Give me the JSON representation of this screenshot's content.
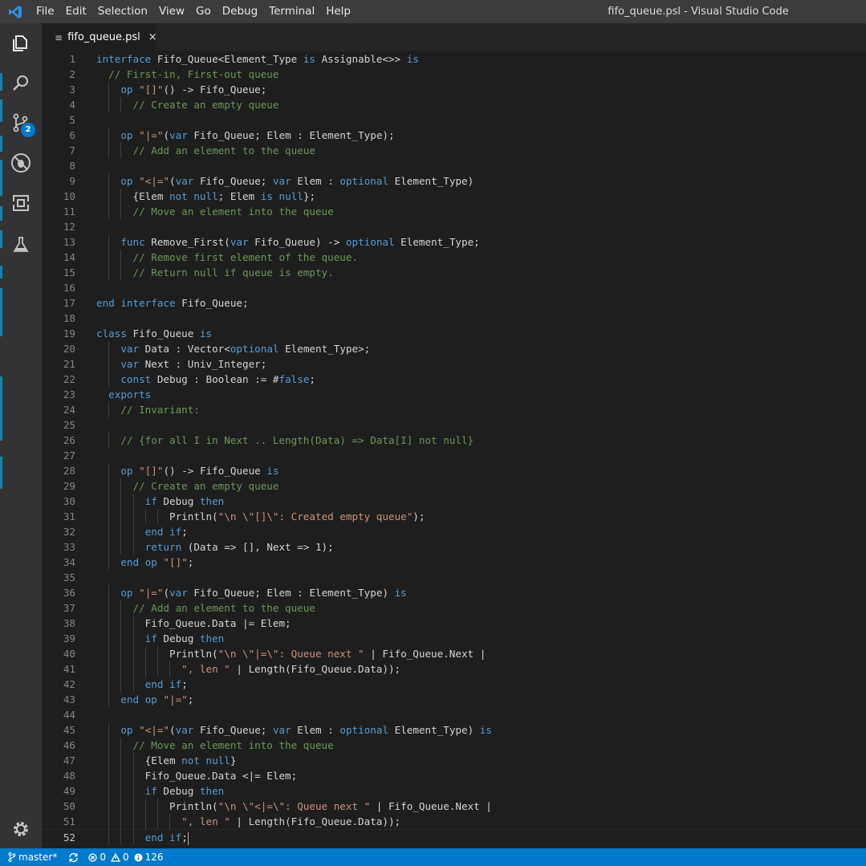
{
  "window": {
    "title": "fifo_queue.psl - Visual Studio Code"
  },
  "menu": [
    "File",
    "Edit",
    "Selection",
    "View",
    "Go",
    "Debug",
    "Terminal",
    "Help"
  ],
  "activity": {
    "items": [
      "explorer-icon",
      "search-icon",
      "source-control-icon",
      "debug-icon",
      "extensions-icon",
      "test-icon"
    ],
    "scm_badge": "2",
    "settings": "gear-icon"
  },
  "tab": {
    "label": "fifo_queue.psl",
    "close": "×"
  },
  "colors": {
    "keyword": "#569cd6",
    "comment": "#6a9955",
    "string": "#ce9178",
    "status": "#007acc"
  },
  "code": [
    {
      "n": "1",
      "t": "interface Fifo_Queue<Element_Type is Assignable<>> is"
    },
    {
      "n": "2",
      "t": "  // First-in, First-out queue"
    },
    {
      "n": "3",
      "t": "    op \"[]\"() -> Fifo_Queue;"
    },
    {
      "n": "4",
      "t": "      // Create an empty queue"
    },
    {
      "n": "5",
      "t": ""
    },
    {
      "n": "6",
      "t": "    op \"|=\"(var Fifo_Queue; Elem : Element_Type);"
    },
    {
      "n": "7",
      "t": "      // Add an element to the queue"
    },
    {
      "n": "8",
      "t": ""
    },
    {
      "n": "9",
      "t": "    op \"<|=\"(var Fifo_Queue; var Elem : optional Element_Type)"
    },
    {
      "n": "10",
      "t": "      {Elem not null; Elem is null};"
    },
    {
      "n": "11",
      "t": "      // Move an element into the queue"
    },
    {
      "n": "12",
      "t": ""
    },
    {
      "n": "13",
      "t": "    func Remove_First(var Fifo_Queue) -> optional Element_Type;"
    },
    {
      "n": "14",
      "t": "      // Remove first element of the queue."
    },
    {
      "n": "15",
      "t": "      // Return null if queue is empty."
    },
    {
      "n": "16",
      "t": ""
    },
    {
      "n": "17",
      "t": "end interface Fifo_Queue;"
    },
    {
      "n": "18",
      "t": ""
    },
    {
      "n": "19",
      "t": "class Fifo_Queue is"
    },
    {
      "n": "20",
      "t": "    var Data : Vector<optional Element_Type>;"
    },
    {
      "n": "21",
      "t": "    var Next : Univ_Integer;"
    },
    {
      "n": "22",
      "t": "    const Debug : Boolean := #false;"
    },
    {
      "n": "23",
      "t": "  exports"
    },
    {
      "n": "24",
      "t": "    // Invariant:"
    },
    {
      "n": "25",
      "t": ""
    },
    {
      "n": "26",
      "t": "    // {for all I in Next .. Length(Data) => Data[I] not null}"
    },
    {
      "n": "27",
      "t": ""
    },
    {
      "n": "28",
      "t": "    op \"[]\"() -> Fifo_Queue is"
    },
    {
      "n": "29",
      "t": "      // Create an empty queue"
    },
    {
      "n": "30",
      "t": "        if Debug then"
    },
    {
      "n": "31",
      "t": "            Println(\"\\n \\\"[]\\\": Created empty queue\");"
    },
    {
      "n": "32",
      "t": "        end if;"
    },
    {
      "n": "33",
      "t": "        return (Data => [], Next => 1);"
    },
    {
      "n": "34",
      "t": "    end op \"[]\";"
    },
    {
      "n": "35",
      "t": ""
    },
    {
      "n": "36",
      "t": "    op \"|=\"(var Fifo_Queue; Elem : Element_Type) is"
    },
    {
      "n": "37",
      "t": "      // Add an element to the queue"
    },
    {
      "n": "38",
      "t": "        Fifo_Queue.Data |= Elem;"
    },
    {
      "n": "39",
      "t": "        if Debug then"
    },
    {
      "n": "40",
      "t": "            Println(\"\\n \\\"|=\\\": Queue next \" | Fifo_Queue.Next |"
    },
    {
      "n": "41",
      "t": "              \", len \" | Length(Fifo_Queue.Data));"
    },
    {
      "n": "42",
      "t": "        end if;"
    },
    {
      "n": "43",
      "t": "    end op \"|=\";"
    },
    {
      "n": "44",
      "t": ""
    },
    {
      "n": "45",
      "t": "    op \"<|=\"(var Fifo_Queue; var Elem : optional Element_Type) is"
    },
    {
      "n": "46",
      "t": "      // Move an element into the queue"
    },
    {
      "n": "47",
      "t": "        {Elem not null}"
    },
    {
      "n": "48",
      "t": "        Fifo_Queue.Data <|= Elem;"
    },
    {
      "n": "49",
      "t": "        if Debug then"
    },
    {
      "n": "50",
      "t": "            Println(\"\\n \\\"<|=\\\": Queue next \" | Fifo_Queue.Next |"
    },
    {
      "n": "51",
      "t": "              \", len \" | Length(Fifo_Queue.Data));"
    },
    {
      "n": "52",
      "t": "        end if;"
    }
  ],
  "status": {
    "branch": "master*",
    "errors": "0",
    "warnings": "0",
    "info": "126"
  }
}
